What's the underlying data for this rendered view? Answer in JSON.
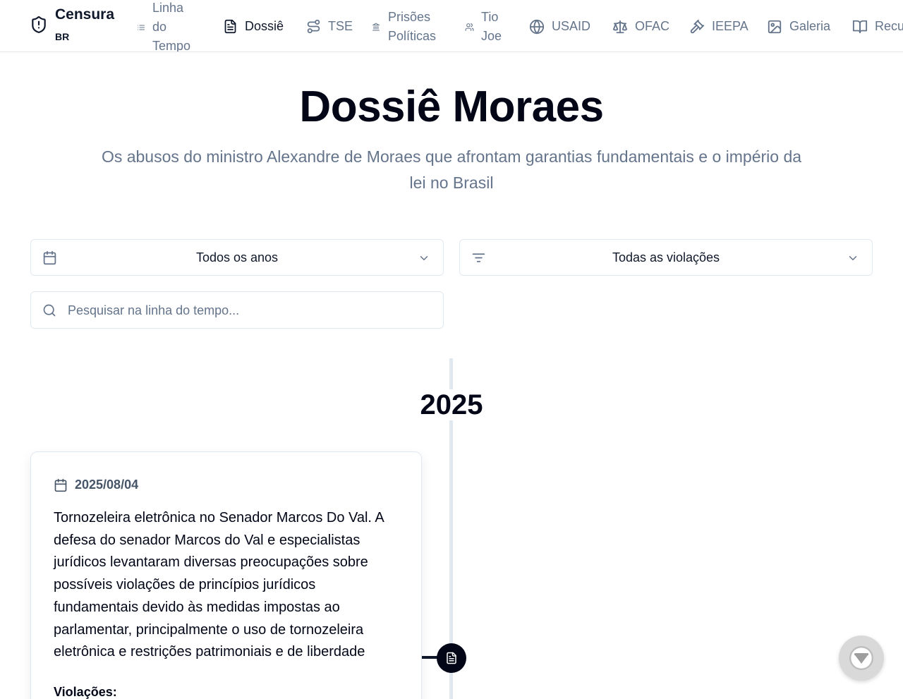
{
  "brand": {
    "title": "Censura",
    "subtitle": "BR",
    "icon": "shield-alert-icon"
  },
  "nav": {
    "timeline": {
      "label": "Linha do Tempo",
      "icon": "list-icon"
    },
    "dossie": {
      "label": "Dossiê",
      "icon": "file-text-icon"
    },
    "tse": {
      "label": "TSE",
      "icon": "route-icon"
    },
    "prisoes": {
      "label": "Prisões Políticas",
      "icon": "landmark-icon"
    },
    "tio_joe": {
      "label": "Tio Joe",
      "icon": "users-icon"
    },
    "usaid": {
      "label": "USAID",
      "icon": "globe-icon"
    },
    "ofac": {
      "label": "OFAC",
      "icon": "scale-icon"
    },
    "ieepa": {
      "label": "IEEPA",
      "icon": "gavel-icon"
    },
    "galeria": {
      "label": "Galeria",
      "icon": "image-icon"
    },
    "recursos": {
      "label": "Recu",
      "icon": "book-open-icon"
    }
  },
  "hero": {
    "title": "Dossiê Moraes",
    "subtitle": "Os abusos do ministro Alexandre de Moraes que afrontam garantias fundamentais e o império da lei no Brasil"
  },
  "filters": {
    "year": {
      "value": "Todos os anos",
      "icon": "calendar-icon"
    },
    "violation": {
      "value": "Todas as violações",
      "icon": "filter-icon"
    },
    "search": {
      "placeholder": "Pesquisar na linha do tempo...",
      "value": "",
      "icon": "search-icon"
    }
  },
  "timeline": {
    "year": "2025",
    "entries": [
      {
        "date": "2025/08/04",
        "text": "Tornozeleira eletrônica no Senador Marcos Do Val. A defesa do senador Marcos do Val e especialistas jurídicos levantaram diversas preocupações sobre possíveis violações de princípios jurídicos fundamentais devido às medidas impostas ao parlamentar, principalmente o uso de tornozeleira eletrônica e restrições patrimoniais e de liberdade",
        "violations_label": "Violações:",
        "marker_icon": "file-text-icon"
      }
    ]
  },
  "colors": {
    "primary": "#020617",
    "muted": "#64748b",
    "border": "#e2e8f0"
  }
}
